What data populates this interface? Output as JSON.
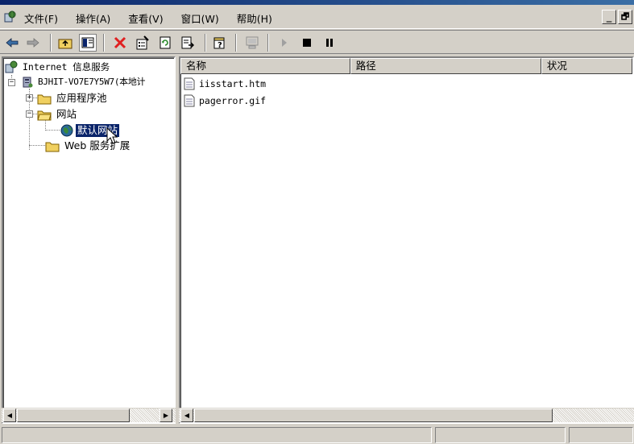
{
  "menu": {
    "items": [
      "文件(F)",
      "操作(A)",
      "查看(V)",
      "窗口(W)",
      "帮助(H)"
    ],
    "minimize_label": "_",
    "restore_label": "🗗"
  },
  "toolbar": {
    "icons": [
      "back-arrow-icon",
      "forward-arrow-icon",
      "up-folder-icon",
      "show-hide-tree-icon",
      "delete-icon",
      "properties-icon",
      "refresh-icon",
      "export-list-icon",
      "help-icon",
      "computer-icon",
      "start-icon",
      "stop-icon",
      "pause-icon"
    ]
  },
  "tree": {
    "root_label": "Internet 信息服务",
    "server_label": "BJHIT-VO7E7Y5W7(本地计",
    "app_pools_label": "应用程序池",
    "websites_label": "网站",
    "default_site_label": "默认网站",
    "web_ext_label": "Web 服务扩展"
  },
  "list": {
    "columns": [
      "名称",
      "路径",
      "状况"
    ],
    "rows": [
      {
        "name": "iisstart.htm"
      },
      {
        "name": "pagerror.gif"
      }
    ]
  },
  "colors": {
    "selection": "#0a246a",
    "face": "#d4d0c8",
    "title": "#0a246a"
  }
}
